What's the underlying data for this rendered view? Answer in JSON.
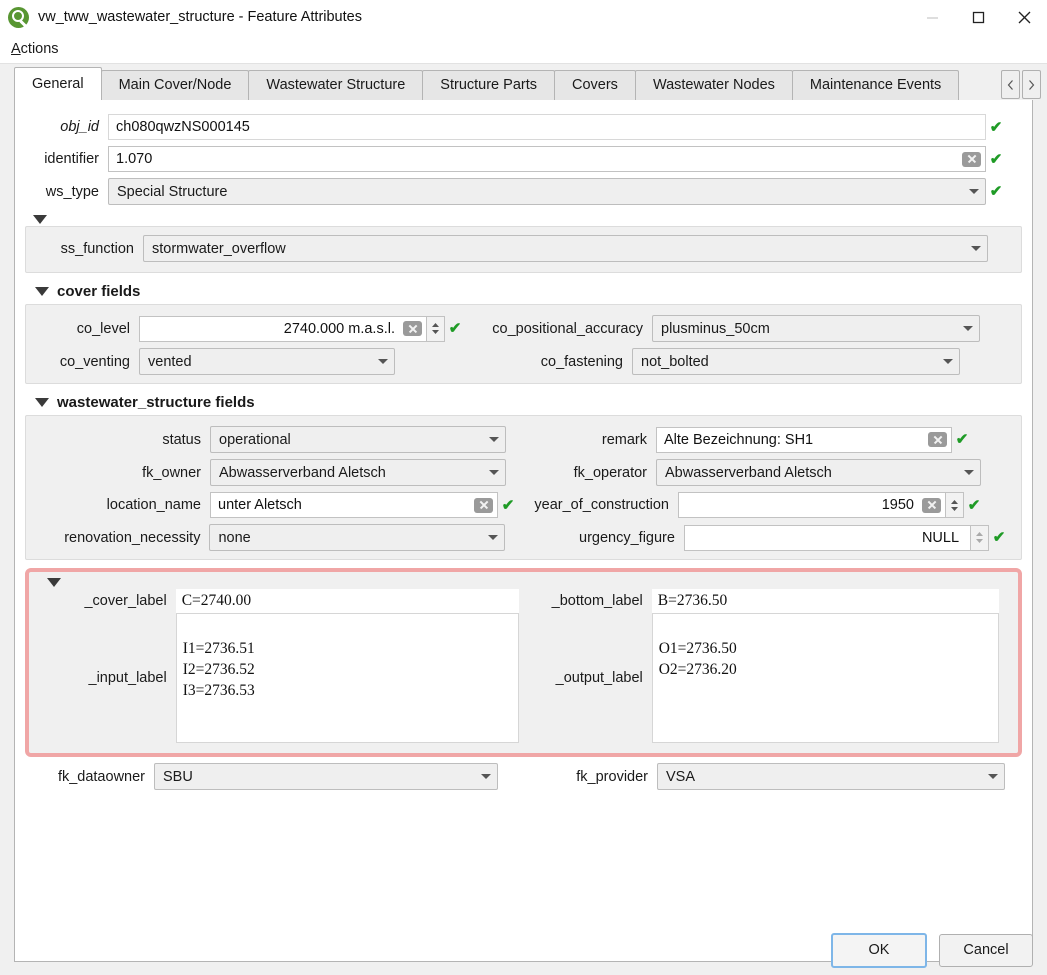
{
  "window": {
    "title": "vw_tww_wastewater_structure - Feature Attributes",
    "logo_icon": "qgis-logo-icon",
    "controls": [
      {
        "name": "minimize-button",
        "icon": "minimize-icon"
      },
      {
        "name": "maximize-button",
        "icon": "maximize-icon"
      },
      {
        "name": "close-button",
        "icon": "close-icon"
      }
    ]
  },
  "menubar": {
    "items": [
      {
        "label": "Actions",
        "mnemonic": "A",
        "rest": "ctions"
      }
    ]
  },
  "tabs": {
    "items": [
      {
        "label": "General",
        "active": true
      },
      {
        "label": "Main Cover/Node",
        "active": false
      },
      {
        "label": "Wastewater Structure",
        "active": false
      },
      {
        "label": "Structure Parts",
        "active": false
      },
      {
        "label": "Covers",
        "active": false
      },
      {
        "label": "Wastewater Nodes",
        "active": false
      },
      {
        "label": "Maintenance Events",
        "active": false
      }
    ],
    "scroll_left_icon": "chevron-left-icon",
    "scroll_right_icon": "chevron-right-icon"
  },
  "form": {
    "obj_id": {
      "label": "obj_id",
      "value": "ch080qwzNS000145",
      "valid": "✔"
    },
    "identifier": {
      "label": "identifier",
      "value": "1.070",
      "valid": "✔"
    },
    "ws_type": {
      "label": "ws_type",
      "value": "Special Structure",
      "valid": "✔"
    },
    "ss_function": {
      "label": "ss_function",
      "value": "stormwater_overflow"
    },
    "cover_fields": {
      "title": "cover fields",
      "co_level": {
        "label": "co_level",
        "value": "2740.000 m.a.s.l.",
        "valid": "✔"
      },
      "co_positional_accuracy": {
        "label": "co_positional_accuracy",
        "value": "plusminus_50cm"
      },
      "co_venting": {
        "label": "co_venting",
        "value": "vented"
      },
      "co_fastening": {
        "label": "co_fastening",
        "value": "not_bolted"
      }
    },
    "wastewater_structure_fields": {
      "title": "wastewater_structure fields",
      "status": {
        "label": "status",
        "value": "operational"
      },
      "remark": {
        "label": "remark",
        "value": "Alte Bezeichnung: SH1",
        "valid": "✔"
      },
      "fk_owner": {
        "label": "fk_owner",
        "value": "Abwasserverband Aletsch"
      },
      "fk_operator": {
        "label": "fk_operator",
        "value": "Abwasserverband Aletsch"
      },
      "location_name": {
        "label": "location_name",
        "value": "unter Aletsch",
        "valid": "✔"
      },
      "year_of_construction": {
        "label": "year_of_construction",
        "value": "1950",
        "valid": "✔"
      },
      "renovation_necessity": {
        "label": "renovation_necessity",
        "value": "none"
      },
      "urgency_figure": {
        "label": "urgency_figure",
        "value": "NULL",
        "valid": "✔"
      }
    },
    "label_fields": {
      "highlight_color": "#f0a6a6",
      "cover_label": {
        "label": "_cover_label",
        "value": "C=2740.00"
      },
      "bottom_label": {
        "label": "_bottom_label",
        "value": "B=2736.50"
      },
      "input_label": {
        "label": "_input_label",
        "value": "I1=2736.51\nI2=2736.52\nI3=2736.53"
      },
      "output_label": {
        "label": "_output_label",
        "value": "O1=2736.50\nO2=2736.20"
      }
    },
    "fk_dataowner": {
      "label": "fk_dataowner",
      "value": "SBU"
    },
    "fk_provider": {
      "label": "fk_provider",
      "value": "VSA"
    }
  },
  "buttons": {
    "ok": "OK",
    "cancel": "Cancel"
  }
}
